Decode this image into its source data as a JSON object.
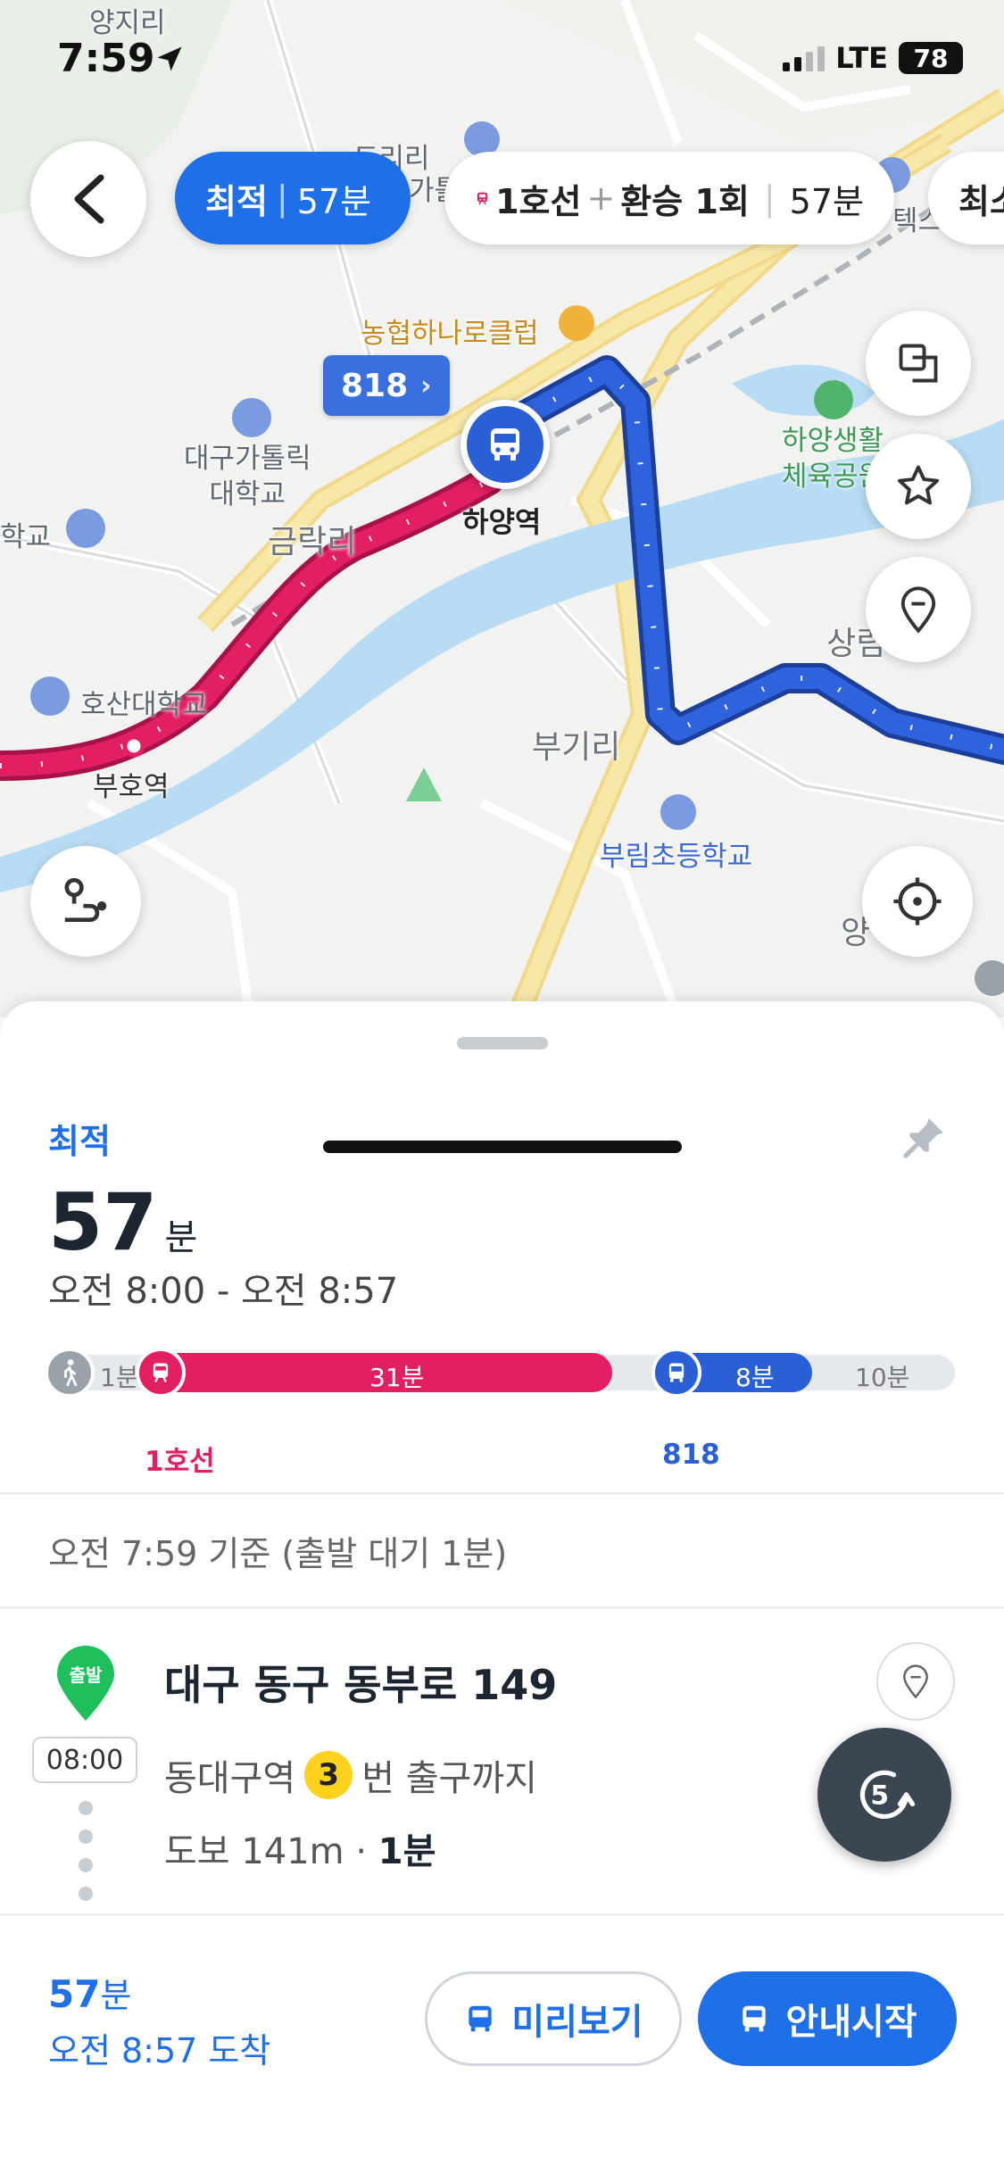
{
  "status": {
    "time": "7:59",
    "network": "LTE",
    "battery": "78"
  },
  "route_chips": {
    "best_label": "최적",
    "best_sep": "|",
    "best_time": "57분",
    "alt_line": "1호선",
    "alt_plus": "+",
    "alt_transfer": "환승 1회",
    "alt_time": "57분",
    "more_label": "최소"
  },
  "map": {
    "labels": {
      "yangji": "양지리",
      "dori": "도리리",
      "gatollik_top": "가톨",
      "nonghyup": "농협하나로클럽",
      "univ": "대구가톨릭\n대학교",
      "geumrak": "금락리",
      "hayang_station": "하양역",
      "hakgyo": "학교",
      "hosan": "호산대학교",
      "buho": "부호역",
      "bugi": "부기리",
      "burim": "부림초등학교",
      "park": "하양생활\n체육공원",
      "sangrim": "상림",
      "yang": "양",
      "texas": "텍스"
    },
    "bus_tag": "818",
    "colors": {
      "subway": "#e21f63",
      "bus": "#2a5fd6",
      "river": "#b7dcf3",
      "road": "#f7e39a"
    }
  },
  "sheet": {
    "best_label": "최적",
    "duration_num": "57",
    "duration_unit": "분",
    "time_range": "오전 8:00 - 오전 8:57",
    "timeline": {
      "walk1": "1분",
      "subway": "31분",
      "bus": "8분",
      "walk2": "10분",
      "subway_name": "1호선",
      "bus_name": "818"
    },
    "basis": "오전 7:59 기준 (출발 대기 1분)",
    "start_badge": "출발",
    "start_time": "08:00",
    "address": "대구 동구 동부로 149",
    "exit_prefix": "동대구역",
    "exit_number": "3",
    "exit_suffix": "번 출구까지",
    "walk_text": "도보 141m ·",
    "walk_min": "1분",
    "float_count": "5"
  },
  "bottom": {
    "minutes": "57",
    "minutes_unit": "분",
    "arrive": "오전 8:57 도착",
    "preview_label": "미리보기",
    "start_label": "안내시작"
  }
}
